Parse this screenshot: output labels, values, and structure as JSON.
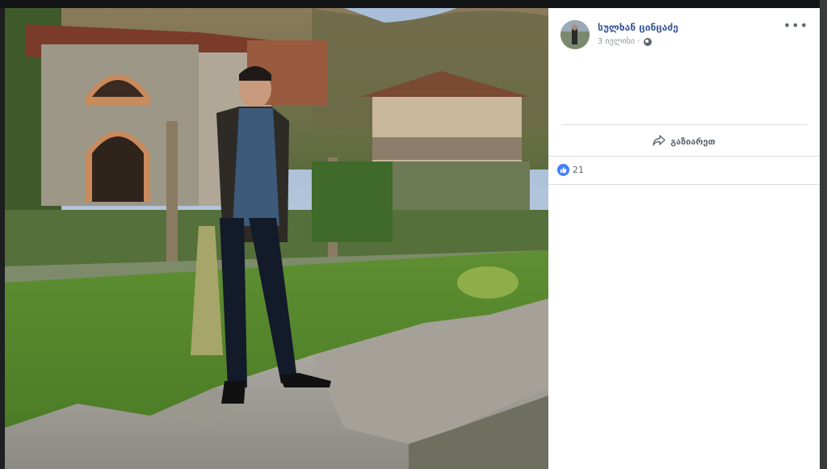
{
  "post": {
    "author_name": "სულხან ცინცაძე",
    "timestamp": "3 ივლისი",
    "separator": "·",
    "privacy_icon": "globe-icon",
    "more_icon": "more-dots-icon",
    "more_glyph": "•••"
  },
  "actions": {
    "share_label": "გაზიარეთ",
    "share_icon": "share-arrow-icon"
  },
  "reactions": {
    "like_icon": "like-thumb-icon",
    "count": "21"
  },
  "photo": {
    "description_icon": "post-photo"
  },
  "colors": {
    "author_link": "#365899",
    "like_blue": "#4080ff",
    "backdrop": "#2f3033"
  }
}
